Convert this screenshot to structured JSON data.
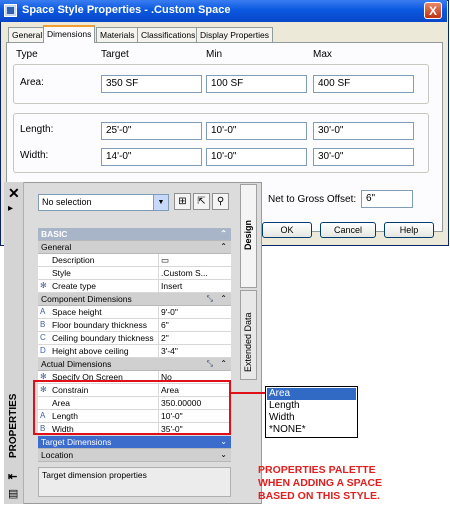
{
  "dialog": {
    "title": "Space Style Properties - .Custom Space",
    "close_glyph": "X",
    "tabs": [
      "General",
      "Dimensions",
      "Materials",
      "Classifications",
      "Display Properties"
    ],
    "active_tab": "Dimensions",
    "headers": {
      "type": "Type",
      "target": "Target",
      "min": "Min",
      "max": "Max"
    },
    "area": {
      "label": "Area:",
      "target": "350 SF",
      "min": "100 SF",
      "max": "400 SF"
    },
    "length": {
      "label": "Length:",
      "target": "25'-0\"",
      "min": "10'-0\"",
      "max": "30'-0\""
    },
    "width": {
      "label": "Width:",
      "target": "14'-0\"",
      "min": "10'-0\"",
      "max": "30'-0\""
    },
    "net_to_gross": {
      "label": "Net to Gross Offset:",
      "value": "6\""
    },
    "buttons": {
      "ok": "OK",
      "cancel": "Cancel",
      "help": "Help"
    }
  },
  "palette": {
    "title": "PROPERTIES",
    "side_tabs": [
      "Design",
      "Extended Data"
    ],
    "selection": "No selection",
    "basic_label": "BASIC",
    "general": {
      "label": "General",
      "rows": [
        {
          "key": "Description",
          "value": "",
          "icon": ""
        },
        {
          "key": "Style",
          "value": ".Custom S...",
          "icon": ""
        },
        {
          "key": "Create type",
          "value": "Insert",
          "icon": "✻"
        }
      ]
    },
    "component_dimensions": {
      "label": "Component Dimensions",
      "rows": [
        {
          "key": "Space height",
          "value": "9'-0\"",
          "icon": "A"
        },
        {
          "key": "Floor boundary thickness",
          "value": "6\"",
          "icon": "B"
        },
        {
          "key": "Ceiling boundary thickness",
          "value": "2\"",
          "icon": "C"
        },
        {
          "key": "Height above ceiling",
          "value": "3'-4\"",
          "icon": "D"
        }
      ]
    },
    "actual_dimensions": {
      "label": "Actual Dimensions",
      "rows": [
        {
          "key": "Specify On Screen",
          "value": "No",
          "icon": "✻"
        },
        {
          "key": "Constrain",
          "value": "Area",
          "icon": "✻"
        },
        {
          "key": "Area",
          "value": "350.00000",
          "icon": ""
        },
        {
          "key": "Length",
          "value": "10'-0\"",
          "icon": "A"
        },
        {
          "key": "Width",
          "value": "35'-0\"",
          "icon": "B"
        }
      ]
    },
    "target_dimensions_label": "Target Dimensions",
    "location_label": "Location",
    "help_text": "Target dimension properties"
  },
  "constrain_dropdown": {
    "options": [
      "Area",
      "Length",
      "Width",
      "*NONE*"
    ],
    "selected": "Area"
  },
  "caption": {
    "line1": "PROPERTIES PALETTE",
    "line2": "WHEN ADDING A SPACE",
    "line3": "BASED ON THIS STYLE."
  },
  "colors": {
    "title_bar": "#0a58e0",
    "highlight_red": "#e0101a",
    "section_blue": "#3c6ccc"
  }
}
